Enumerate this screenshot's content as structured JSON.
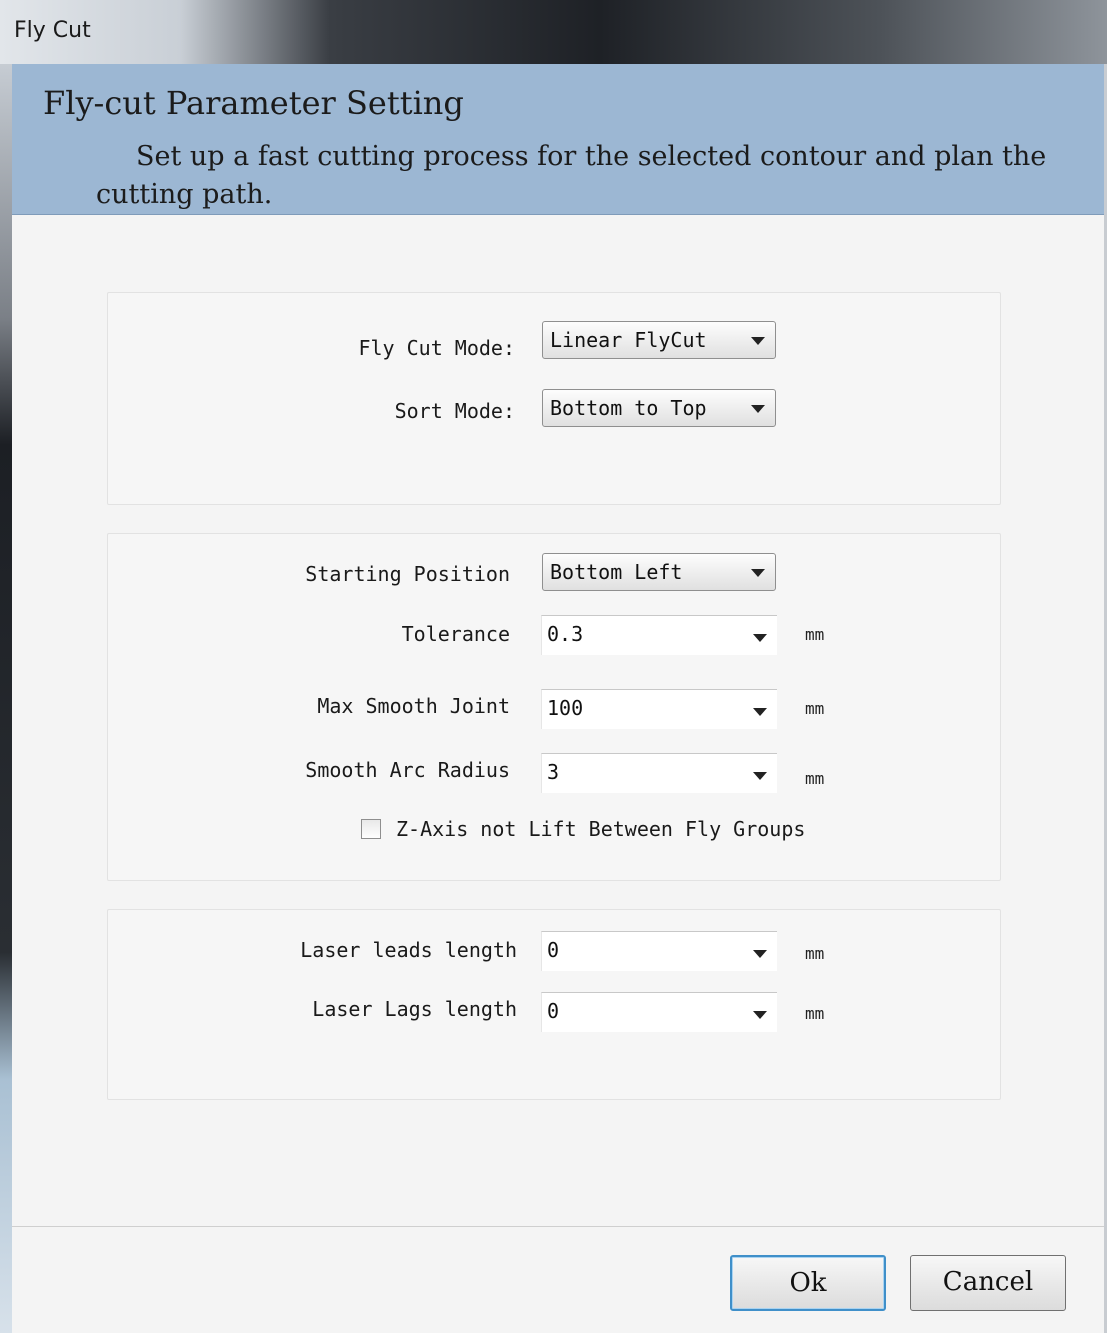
{
  "window": {
    "title": "Fly Cut"
  },
  "banner": {
    "heading": "Fly-cut Parameter Setting",
    "description": "Set up a fast cutting process for the selected contour and plan the cutting path."
  },
  "mode_group": {
    "fly_cut_mode": {
      "label": "Fly Cut Mode:",
      "value": "Linear FlyCut"
    },
    "sort_mode": {
      "label": "Sort Mode:",
      "value": "Bottom to Top"
    }
  },
  "path_group": {
    "starting_position": {
      "label": "Starting Position",
      "value": "Bottom Left"
    },
    "tolerance": {
      "label": "Tolerance",
      "value": "0.3",
      "unit": "mm"
    },
    "max_smooth_joint": {
      "label": "Max Smooth Joint",
      "value": "100",
      "unit": "mm"
    },
    "smooth_arc_radius": {
      "label": "Smooth Arc Radius",
      "value": "3",
      "unit": "mm"
    },
    "z_axis_checkbox": {
      "label": "Z-Axis not Lift Between Fly Groups",
      "checked": false
    }
  },
  "laser_group": {
    "leads_length": {
      "label": "Laser leads length",
      "value": "0",
      "unit": "mm"
    },
    "lags_length": {
      "label": "Laser Lags length",
      "value": "0",
      "unit": "mm"
    }
  },
  "buttons": {
    "ok": "Ok",
    "cancel": "Cancel"
  }
}
